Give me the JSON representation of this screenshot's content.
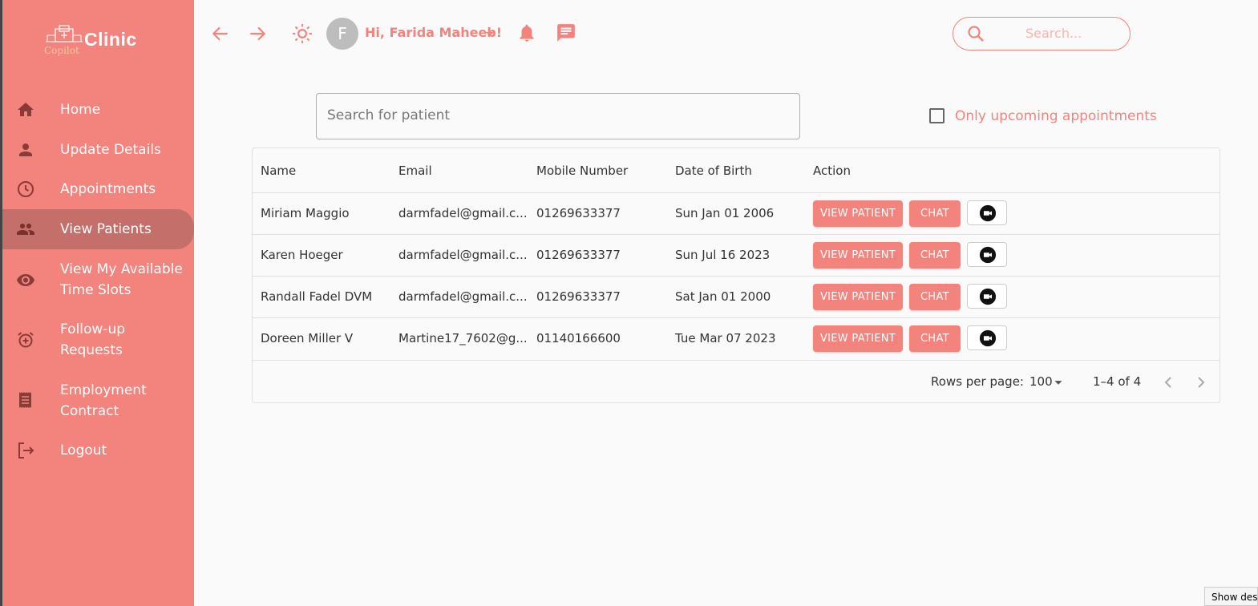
{
  "app": {
    "logo_text": "Clinic",
    "logo_subtext": "Copilot"
  },
  "sidebar": {
    "items": [
      {
        "label": "Home",
        "icon": "home-icon"
      },
      {
        "label": "Update Details",
        "icon": "person-icon"
      },
      {
        "label": "Appointments",
        "icon": "clock-icon"
      },
      {
        "label": "View Patients",
        "icon": "people-icon",
        "active": true
      },
      {
        "label": "View My Available Time Slots",
        "icon": "eye-icon"
      },
      {
        "label": "Follow-up Requests",
        "icon": "alarm-add-icon"
      },
      {
        "label": "Employment Contract",
        "icon": "receipt-icon"
      },
      {
        "label": "Logout",
        "icon": "logout-icon"
      }
    ]
  },
  "header": {
    "avatar_initial": "F",
    "greeting": "Hi, Farida Maheeb!",
    "search_placeholder": "Search..."
  },
  "filters": {
    "patient_search_placeholder": "Search for patient",
    "upcoming_label": "Only upcoming appointments",
    "upcoming_checked": false
  },
  "table": {
    "columns": [
      "Name",
      "Email",
      "Mobile Number",
      "Date of Birth",
      "Action"
    ],
    "rows": [
      {
        "name": "Miriam Maggio",
        "email": "darmfadel@gmail.c...",
        "mobile": "01269633377",
        "dob": "Sun Jan 01 2006"
      },
      {
        "name": "Karen Hoeger",
        "email": "darmfadel@gmail.c...",
        "mobile": "01269633377",
        "dob": "Sun Jul 16 2023"
      },
      {
        "name": "Randall Fadel DVM",
        "email": "darmfadel@gmail.c...",
        "mobile": "01269633377",
        "dob": "Sat Jan 01 2000"
      },
      {
        "name": "Doreen Miller V",
        "email": "Martine17_7602@g...",
        "mobile": "01140166600",
        "dob": "Tue Mar 07 2023"
      }
    ],
    "view_button_label": "VIEW PATIENT",
    "chat_button_label": "CHAT",
    "pagination": {
      "rows_per_page_label": "Rows per page:",
      "rows_per_page_value": "100",
      "range": "1–4 of 4"
    }
  },
  "taskbar": {
    "show_desktop": "Show desktop"
  },
  "colors": {
    "accent": "#f2837d",
    "sidebar_active": "#c46f6a"
  }
}
